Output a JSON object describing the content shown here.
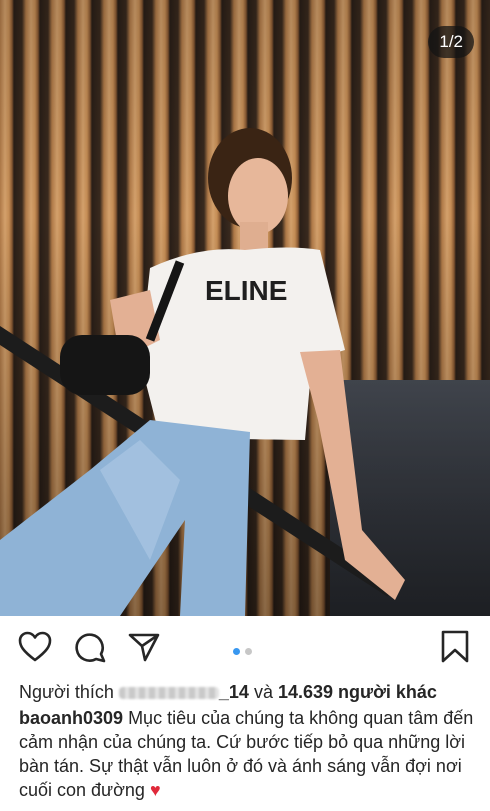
{
  "post": {
    "image_counter": "1/2",
    "likes_prefix": "Người thích",
    "likes_user_suffix": "_14",
    "likes_connector": "và",
    "likes_count": "14.639 người khác",
    "caption_user": "baoanh0309",
    "caption_text": "Mục tiêu của chúng ta không quan tâm đến cảm nhận của chúng ta. Cứ bước tiếp bỏ qua những lời bàn tán. Sự thật vẫn luôn ở đó và ánh sáng vẫn đợi nơi cuối con đường",
    "caption_emoji": "♥",
    "shirt_print": "ELINE"
  },
  "carousel": {
    "count": 2,
    "active": 0
  },
  "icons": [
    "heart-icon",
    "comment-icon",
    "share-icon",
    "bookmark-icon"
  ],
  "colors": {
    "active_dot": "#3897f0",
    "inactive_dot": "#c7c7c7",
    "emoji": "#e0293a"
  }
}
